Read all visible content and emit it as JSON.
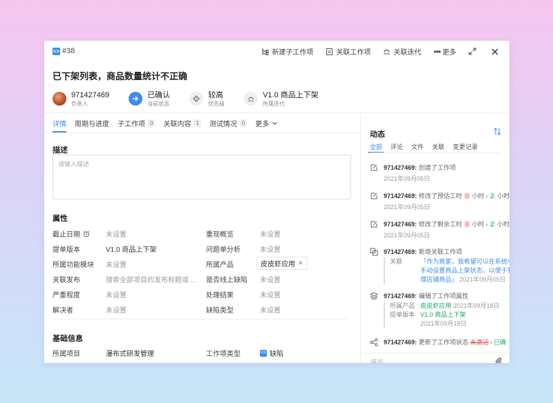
{
  "ticket": {
    "id": "#38",
    "title": "已下架列表，商品数量统计不正确"
  },
  "actions": {
    "new_child": "新建子工作项",
    "link_item": "关联工作项",
    "link_iteration": "关联迭代",
    "more": "更多"
  },
  "meta": {
    "assignee": {
      "value": "971427469",
      "label": "负责人"
    },
    "status": {
      "value": "已确认",
      "label": "当前状态"
    },
    "priority": {
      "value": "较高",
      "label": "优先级"
    },
    "iteration": {
      "value": "V1.0 商品上下架",
      "label": "所属迭代"
    }
  },
  "tabs": [
    {
      "label": "详情",
      "active": true
    },
    {
      "label": "周期与进度"
    },
    {
      "label": "子工作项",
      "count": "0"
    },
    {
      "label": "关联内容",
      "count": "1"
    },
    {
      "label": "测试情况",
      "count": "0"
    },
    {
      "label": "更多"
    }
  ],
  "description": {
    "heading": "描述",
    "placeholder": "请输入描述"
  },
  "properties": {
    "heading": "属性",
    "left": [
      {
        "label": "截止日期",
        "value": "未设置"
      },
      {
        "label": "提单版本",
        "value": "V1.0 商品上下架"
      },
      {
        "label": "所属功能模块",
        "value": "未设置"
      },
      {
        "label": "关联发布",
        "value": "搜索全部项目的发布标题或 ..."
      },
      {
        "label": "严重程度",
        "value": "未设置"
      },
      {
        "label": "解决者",
        "value": "未设置"
      }
    ],
    "right": [
      {
        "label": "重现概览",
        "value": "未设置"
      },
      {
        "label": "问题单分析",
        "value": "未设置"
      },
      {
        "label": "所属产品",
        "value": "皮皮虾应用"
      },
      {
        "label": "是否线上缺陷",
        "value": "未设置"
      },
      {
        "label": "处理结果",
        "value": "未设置"
      },
      {
        "label": "缺陷类型",
        "value": "未设置"
      }
    ]
  },
  "basic_info": {
    "heading": "基础信息",
    "project_label": "所属项目",
    "project_value": "瀑布式研发管理",
    "type_label": "工作项类型",
    "type_value": "缺陷"
  },
  "activity": {
    "heading": "动态",
    "tabs": [
      "全部",
      "评论",
      "文件",
      "关联",
      "变更记录"
    ],
    "items": [
      {
        "user": "971427469:",
        "action": "创建了工作项",
        "date": "2021年09月05日"
      },
      {
        "user": "971427469:",
        "action": "修改了预估工时",
        "from": "0",
        "from_unit": "小时",
        "to": "2",
        "to_unit": "小时",
        "date": "2021年09月05日"
      },
      {
        "user": "971427469:",
        "action": "修改了剩余工时",
        "from": "0",
        "from_unit": "小时",
        "to": "2",
        "to_unit": "小时",
        "date": "2021年09月05日"
      },
      {
        "user": "971427469:",
        "action": "新增关联工作项",
        "sub_label": "关联",
        "sub_line1": "「作为商家，我希望可以在系统中",
        "sub_line2": "手动设置商品上架状态，以便于管",
        "sub_line3": "理店铺商品」",
        "sub_date": "2021年09月05日"
      },
      {
        "user": "971427469:",
        "action": "编辑了工作项属性",
        "sub1_label": "所属产品",
        "sub1_value": "皮皮虾应用",
        "sub1_date": "2021年09月18日",
        "sub2_label": "提单版本",
        "sub2_value": "V1.0 商品上下架",
        "sub2_date": "2021年09月18日"
      },
      {
        "user": "971427469:",
        "action": "更新了工作项状态",
        "from": "未激活",
        "to": "已确"
      }
    ]
  },
  "comment_placeholder": "评论"
}
